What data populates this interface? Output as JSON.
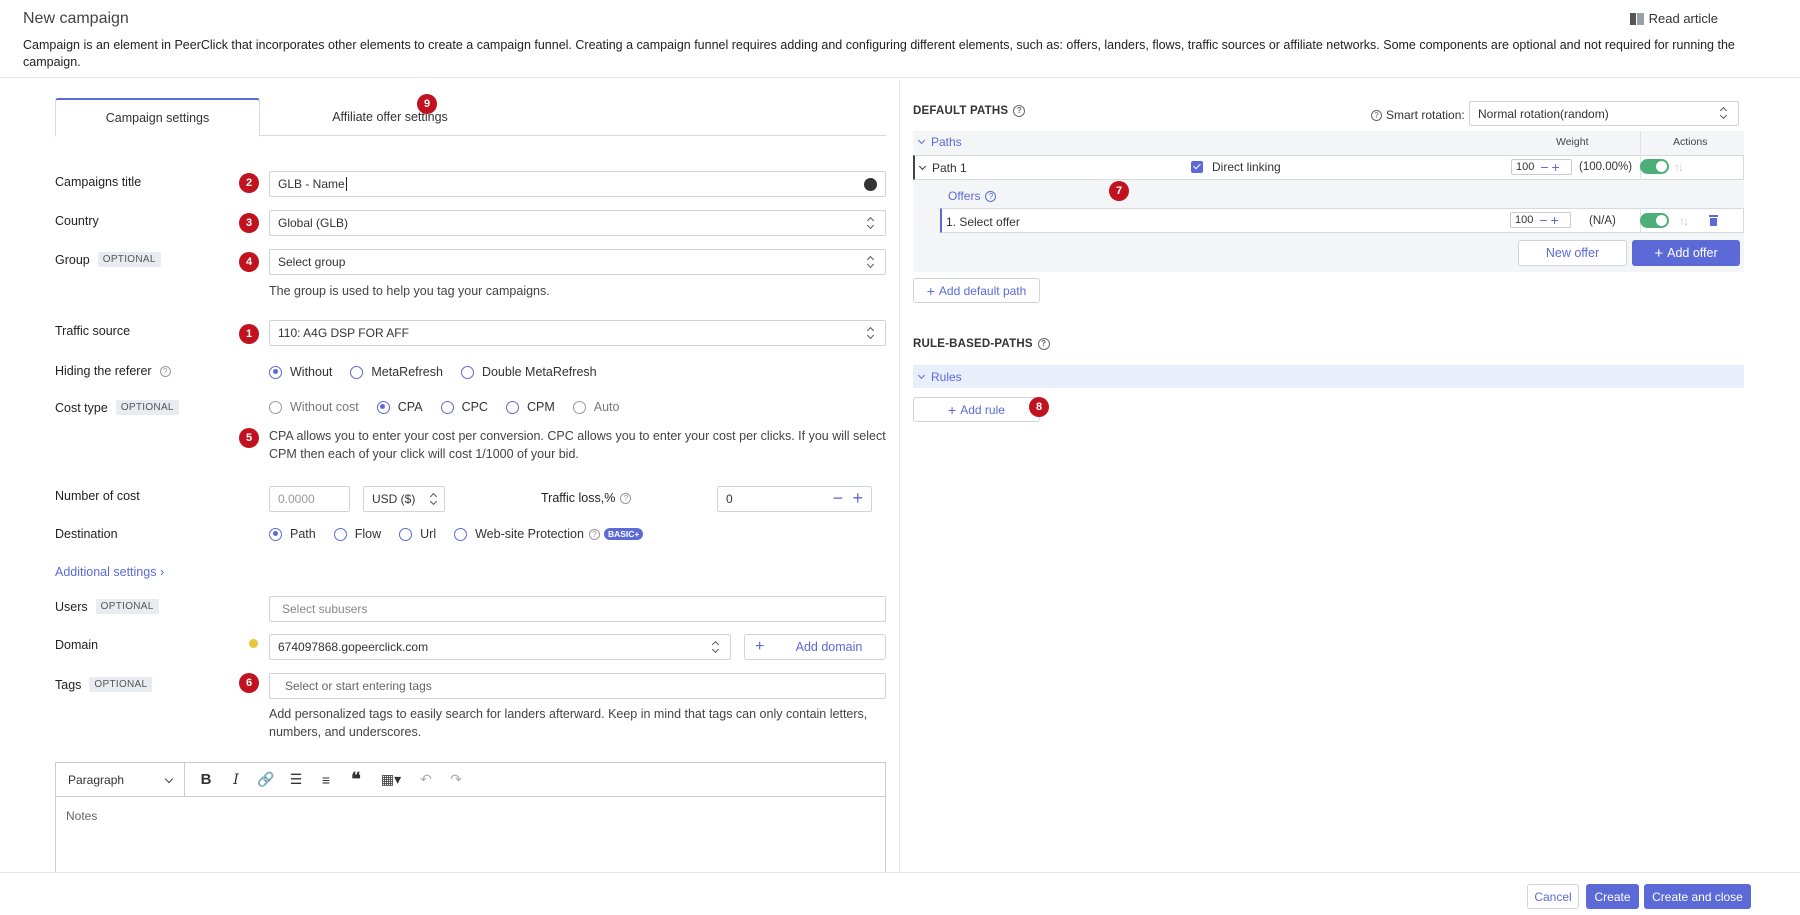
{
  "header": {
    "title": "New campaign",
    "read_article": "Read article",
    "description": "Campaign is an element in PeerClick that incorporates other elements to create a campaign funnel. Creating a campaign funnel requires adding and configuring different elements, such as: offers, landers, flows, traffic sources or affiliate networks. Some components are optional and not required for running the campaign."
  },
  "tabs": {
    "campaign_settings": "Campaign settings",
    "affiliate_offer_settings": "Affiliate offer settings"
  },
  "markers": {
    "m1": "1",
    "m2": "2",
    "m3": "3",
    "m4": "4",
    "m5": "5",
    "m6": "6",
    "m7": "7",
    "m8": "8",
    "m9": "9"
  },
  "form": {
    "optional": "OPTIONAL",
    "campaigns_title": {
      "label": "Campaigns title",
      "value": "GLB - Name"
    },
    "country": {
      "label": "Country",
      "value": "Global (GLB)"
    },
    "group": {
      "label": "Group",
      "placeholder": "Select group",
      "help": "The group is used to help you tag your campaigns."
    },
    "traffic_source": {
      "label": "Traffic source",
      "value": "110: A4G DSP FOR AFF"
    },
    "hiding_referer": {
      "label": "Hiding the referer",
      "options": [
        "Without",
        "MetaRefresh",
        "Double MetaRefresh"
      ],
      "selected": "Without"
    },
    "cost_type": {
      "label": "Cost type",
      "options": [
        "Without cost",
        "CPA",
        "CPC",
        "CPM",
        "Auto"
      ],
      "selected": "CPA",
      "help": "CPA allows you to enter your cost per conversion. CPC allows you to enter your cost per clicks. If you will select CPM then each of your click will cost 1/1000 of your bid."
    },
    "number_of_cost": {
      "label": "Number of cost",
      "placeholder": "0.0000",
      "currency": "USD ($)"
    },
    "traffic_loss": {
      "label": "Traffic loss,%",
      "value": "0"
    },
    "destination": {
      "label": "Destination",
      "options": [
        "Path",
        "Flow",
        "Url",
        "Web-site Protection"
      ],
      "selected": "Path",
      "badge": "BASIC+"
    },
    "additional_settings": "Additional settings",
    "users": {
      "label": "Users",
      "placeholder": "Select subusers"
    },
    "domain": {
      "label": "Domain",
      "value": "674097868.gopeerclick.com",
      "add_label": "Add domain"
    },
    "tags": {
      "label": "Tags",
      "placeholder": "Select or start entering tags",
      "help": "Add personalized tags to easily search for landers afterward. Keep in mind that tags can only contain letters, numbers, and underscores."
    }
  },
  "editor": {
    "paragraph": "Paragraph",
    "placeholder": "Notes"
  },
  "footer": {
    "cancel": "Cancel",
    "create": "Create",
    "create_and_close": "Create and close"
  },
  "right": {
    "default_paths_title": "DEFAULT PATHS",
    "smart_rotation_label": "Smart rotation:",
    "smart_rotation_value": "Normal rotation(random)",
    "paths_header": "Paths",
    "weight_header": "Weight",
    "actions_header": "Actions",
    "path": {
      "name": "Path 1",
      "direct_linking": "Direct linking",
      "weight": "100",
      "percent": "(100.00%)",
      "direct_linking_checked": true,
      "active": true
    },
    "offers_label": "Offers",
    "offer": {
      "name": "1. Select offer",
      "weight": "100",
      "percent": "(N/A)",
      "active": true
    },
    "new_offer": "New offer",
    "add_offer": "Add offer",
    "add_default_path": "Add default path",
    "rule_based_title": "RULE-BASED-PATHS",
    "rules_header": "Rules",
    "add_rule": "Add rule"
  },
  "colors": {
    "accent": "#5b6ad6",
    "marker": "#c0121f",
    "toggle_on": "#4caf78"
  },
  "icons": [
    "book-icon",
    "help-circle-icon",
    "dot-icon",
    "plus-icon",
    "minus-icon",
    "trash-icon",
    "chevron-down-icon",
    "sort-arrows-icon",
    "warning-dot-icon"
  ]
}
